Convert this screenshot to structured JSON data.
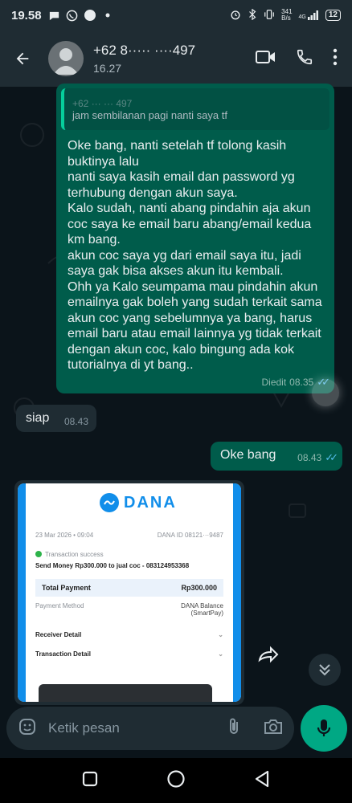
{
  "status_bar": {
    "time": "19.58",
    "network_speed": "341\nB/s",
    "signal_label": "4G",
    "battery": "12"
  },
  "header": {
    "contact_name": "+62 8····· ····497",
    "subtitle": "16.27"
  },
  "messages": [
    {
      "direction": "outgoing",
      "quote_author": "+62 ··· ··· 497",
      "quote_text": "jam sembilanan pagi nanti saya tf",
      "text": "Oke bang, nanti setelah tf tolong kasih buktinya lalu\nnanti saya kasih email dan password yg terhubung dengan akun saya.\nKalo sudah, nanti abang pindahin aja akun coc saya ke email baru abang/email kedua km bang.\nakun coc saya yg dari email saya itu, jadi saya gak bisa akses akun itu kembali.\nOhh ya Kalo seumpama mau pindahin akun emailnya gak boleh yang sudah terkait sama akun coc yang sebelumnya ya bang, harus email baru atau email lainnya yg tidak terkait dengan akun coc, kalo bingung ada kok tutorialnya di yt bang..",
      "edited_label": "Diedit",
      "time": "08.35",
      "status": "read"
    },
    {
      "direction": "incoming",
      "text": "siap",
      "time": "08.43"
    },
    {
      "direction": "outgoing",
      "text": "Oke bang",
      "time": "08.43",
      "status": "read"
    },
    {
      "direction": "incoming",
      "type": "image",
      "receipt": {
        "brand": "DANA",
        "date": "23 Mar 2026 • 09:04",
        "tx_id": "DANA ID 08121···9487",
        "status": "Transaction success",
        "description": "Send Money Rp300.000 to jual coc - 083124953368",
        "total_label": "Total Payment",
        "total_value": "Rp300.000",
        "method_label": "Payment Method",
        "method_value": "DANA Balance",
        "method_sub": "(SmartPay)",
        "receiver_label": "Receiver Detail",
        "transaction_label": "Transaction Detail"
      }
    }
  ],
  "composer": {
    "placeholder": "Ketik pesan"
  },
  "icons": {
    "back": "arrow-left-icon",
    "video": "video-call-icon",
    "call": "phone-icon",
    "more": "more-vert-icon",
    "emoji": "sticker-icon",
    "attach": "paperclip-icon",
    "camera": "camera-icon",
    "mic": "mic-icon",
    "forward": "forward-icon",
    "scroll": "chevron-double-down-icon"
  },
  "colors": {
    "header_bg": "#1f2c33",
    "chat_bg": "#0b141a",
    "outgoing_bubble": "#005c4b",
    "incoming_bubble": "#1f2c33",
    "accent": "#00a884",
    "read_ticks": "#53bdeb",
    "dana_blue": "#118eea"
  }
}
